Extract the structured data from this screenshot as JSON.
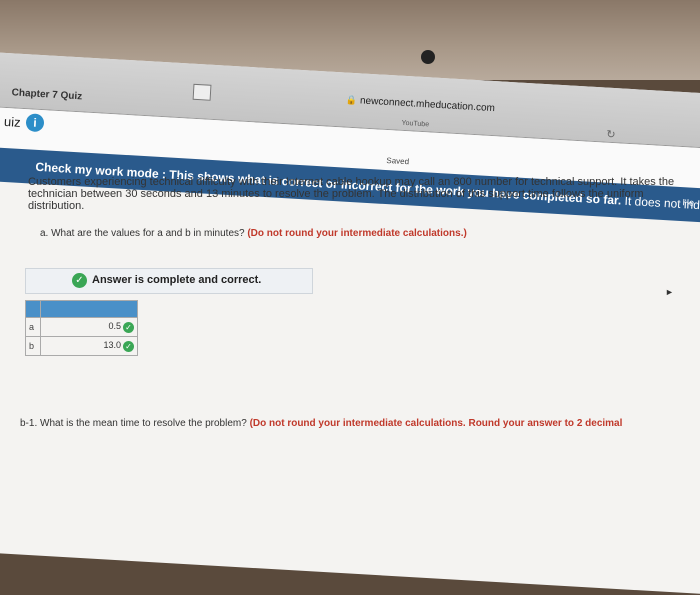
{
  "browser": {
    "tab_title": "Chapter 7 Quiz",
    "address": "newconnect.mheducation.com",
    "secondary_tab": "YouTube",
    "lock_icon": "lock-icon",
    "reload_glyph": "↻"
  },
  "quiz": {
    "label": "uiz",
    "info_glyph": "i",
    "saved_label": "Saved"
  },
  "banner": {
    "mode_label": "Check my work mode : This shows what is correct or incorrect for the work you have completed so far.",
    "note": " It does not indicate com",
    "right_text": "He"
  },
  "question": {
    "line1": "Customers experiencing technical difficulty with their Internet cable hookup may call an 800 number for technical support. It takes the",
    "line2": "technician between 30 seconds and 13 minutes to resolve the problem. The distribution of this support time follows the uniform",
    "line3": "distribution."
  },
  "part_a": {
    "label": "a. What are the values for a and b in minutes?",
    "hint": "(Do not round your intermediate calculations.)"
  },
  "answer": {
    "status": "Answer is complete and correct.",
    "check_glyph": "✓",
    "rows": [
      {
        "var": "a",
        "value": "0.5"
      },
      {
        "var": "b",
        "value": "13.0"
      }
    ]
  },
  "part_b1": {
    "label": "b-1. What is the mean time to resolve the problem?",
    "hint": "(Do not round your intermediate calculations. Round your answer to 2 decimal"
  },
  "colors": {
    "banner": "#2a5a8c",
    "correct": "#3aa655",
    "hint": "#c0392b"
  }
}
